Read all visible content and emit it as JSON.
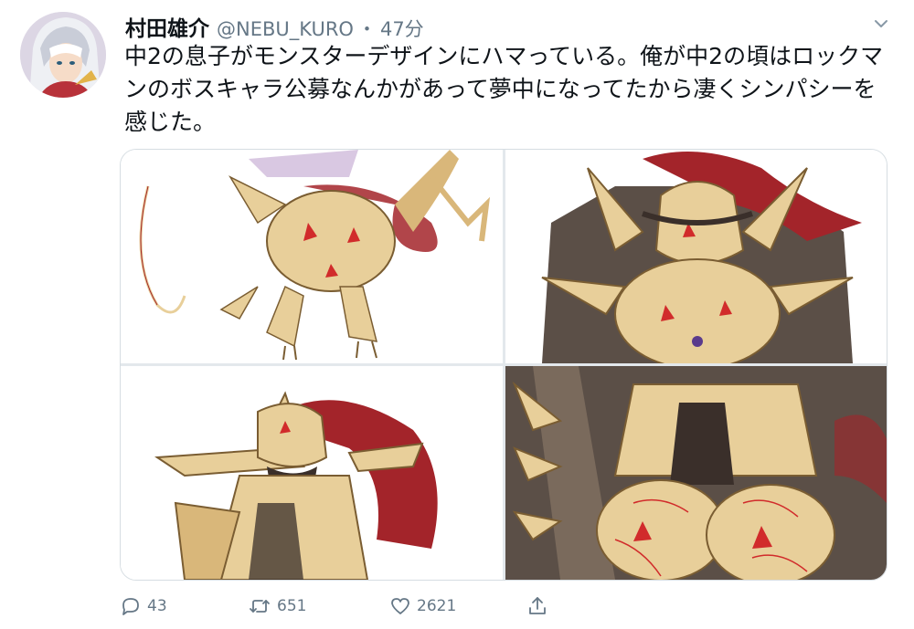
{
  "author": {
    "display_name": "村田雄介",
    "handle": "@NEBU_KURO",
    "separator": "・",
    "timestamp": "47分"
  },
  "tweet": {
    "text": "中2の息子がモンスターデザインにハマっている。俺が中2の頃はロックマンのボスキャラ公募なんかがあって夢中になってたから凄くシンパシーを感じた。"
  },
  "media": {
    "count": 4,
    "images": [
      {
        "subject": "dragon-monster-full-body"
      },
      {
        "subject": "dragon-monster-upper-body"
      },
      {
        "subject": "dragon-monster-head"
      },
      {
        "subject": "dragon-monster-torso-detail"
      }
    ]
  },
  "actions": {
    "reply_count": "43",
    "retweet_count": "651",
    "like_count": "2621"
  },
  "icons": {
    "reply": "reply-icon",
    "retweet": "retweet-icon",
    "like": "heart-icon",
    "share": "share-icon",
    "menu": "chevron-down-icon"
  },
  "colors": {
    "muted": "#657786",
    "text": "#0f1419",
    "border": "#d6dde2",
    "monster_bone": "#e8cf9a",
    "monster_red": "#a3242a"
  }
}
